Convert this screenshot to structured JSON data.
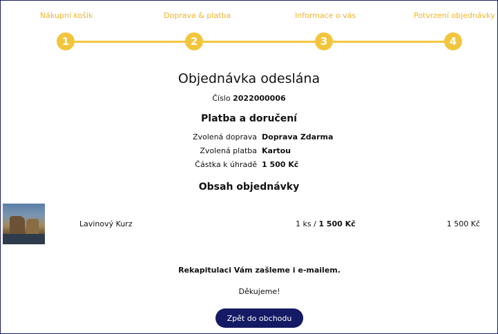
{
  "stepper": {
    "steps": [
      {
        "label": "Nákupní košík",
        "number": "1"
      },
      {
        "label": "Doprava & platba",
        "number": "2"
      },
      {
        "label": "Informace o vás",
        "number": "3"
      },
      {
        "label": "Potvrzení objednávky",
        "number": "4"
      }
    ]
  },
  "confirmation": {
    "title": "Objednávka odeslána",
    "order_label": "Číslo",
    "order_number": "2022000006"
  },
  "payment": {
    "heading": "Platba a doručení",
    "rows": [
      {
        "label": "Zvolená doprava",
        "value": "Doprava Zdarma"
      },
      {
        "label": "Zvolená platba",
        "value": "Kartou"
      },
      {
        "label": "Částka k úhradě",
        "value": "1 500 Kč"
      }
    ]
  },
  "order_contents": {
    "heading": "Obsah objednávky",
    "items": [
      {
        "name": "Lavinový Kurz",
        "quantity": "1 ks",
        "separator": "/",
        "unit_price": "1 500 Kč",
        "total": "1 500 Kč"
      }
    ]
  },
  "footer": {
    "recap_text": "Rekapitulaci Vám zašleme i e-mailem.",
    "thanks_text": "Děkujeme!",
    "back_button_label": "Zpět do obchodu"
  },
  "colors": {
    "accent_yellow": "#f3c53c",
    "button_navy": "#141a64"
  }
}
